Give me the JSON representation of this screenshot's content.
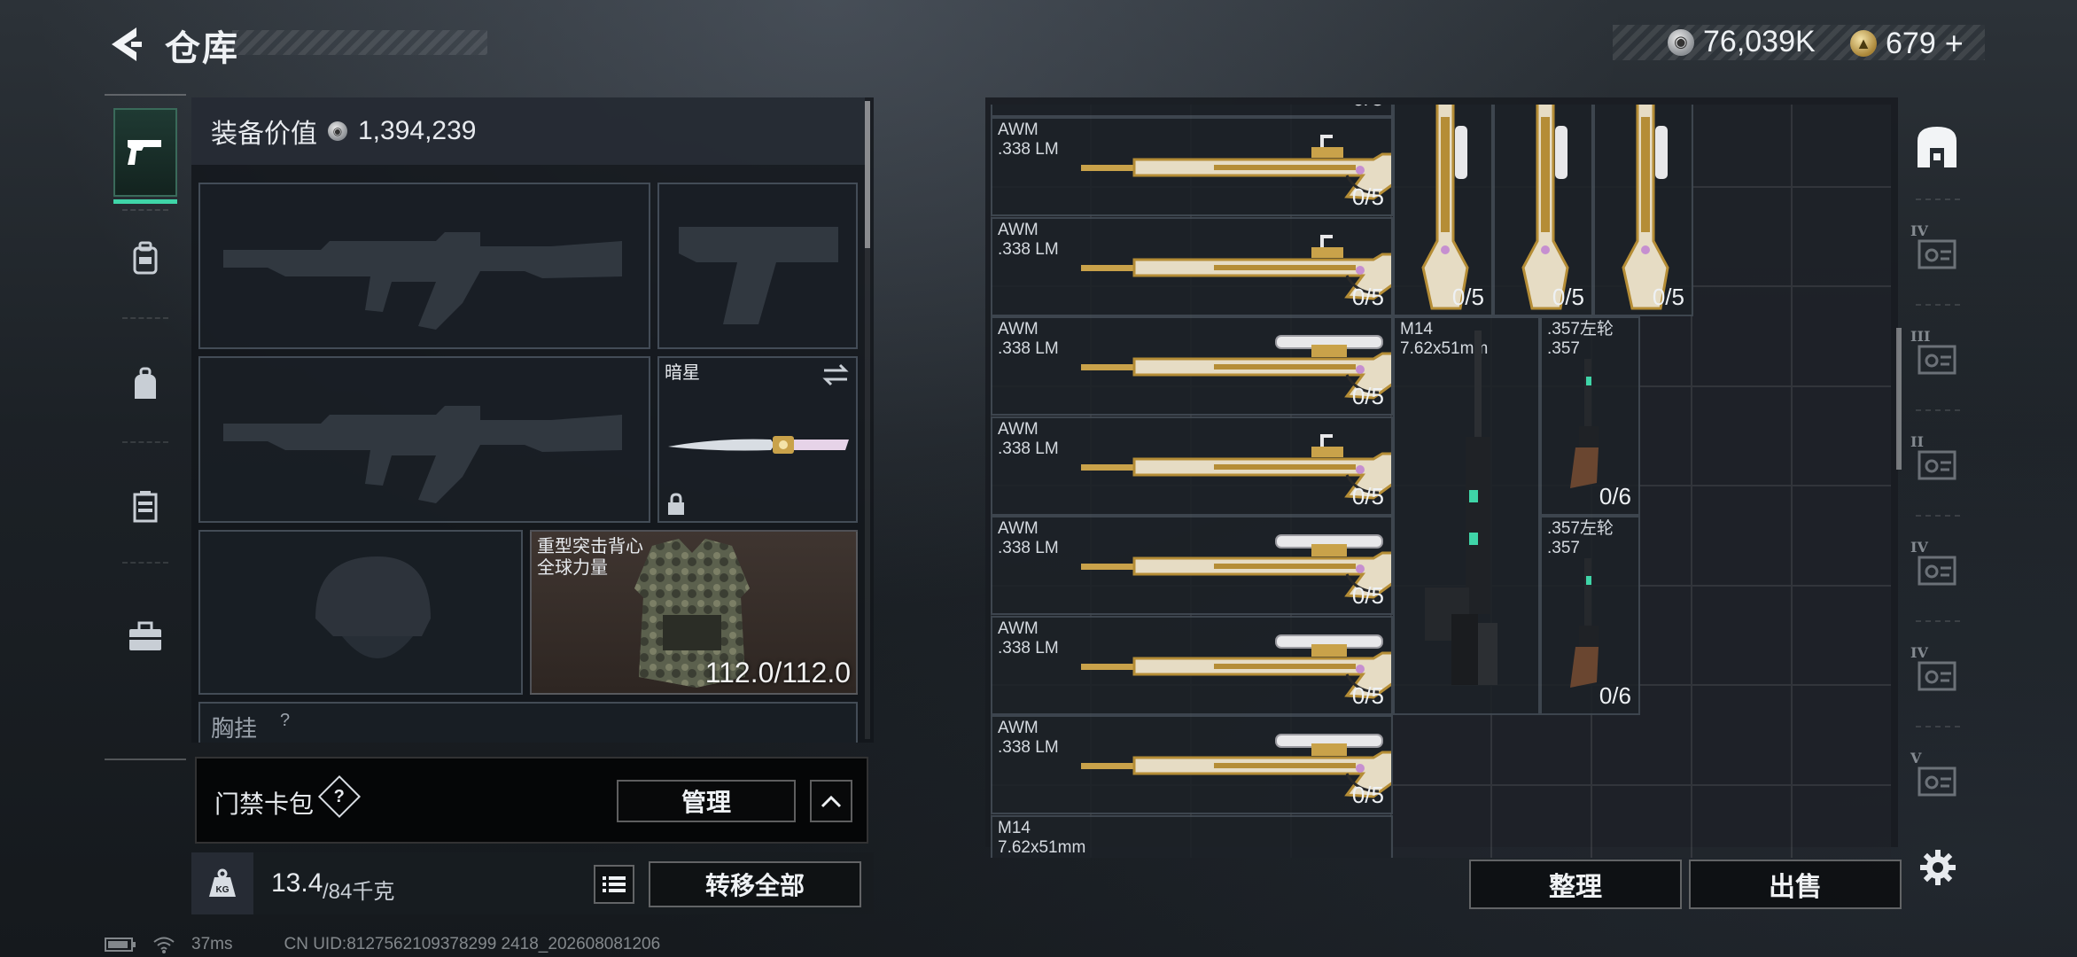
{
  "header": {
    "title": "仓库",
    "currency_silver": "76,039K",
    "currency_gold": "679",
    "gold_plus": "+"
  },
  "left_nav": {
    "items": [
      "pistol-icon",
      "backpack-icon",
      "bag-icon",
      "vest-icon",
      "toolbox-icon"
    ],
    "active_index": 0
  },
  "equipment": {
    "value_label": "装备价值",
    "value": "1,394,239",
    "melee_label": "暗星",
    "armor_name": "重型突击背心",
    "armor_brand": "全球力量",
    "armor_durability": "112.0/112.0",
    "chest_label": "胸挂",
    "chest_help": "?"
  },
  "keycard": {
    "label": "门禁卡包",
    "help": "?",
    "manage": "管理"
  },
  "weight": {
    "current": "13.4",
    "max": "/84千克",
    "transfer_all": "转移全部"
  },
  "stash": {
    "awm_rows": [
      {
        "name": "AWM\n.338 LM",
        "count": "0/5",
        "scope": "red-dot"
      },
      {
        "name": "AWM\n.338 LM",
        "count": "0/5",
        "scope": "red-dot"
      },
      {
        "name": "AWM\n.338 LM",
        "count": "0/5",
        "scope": "long"
      },
      {
        "name": "AWM\n.338 LM",
        "count": "0/5",
        "scope": "red-dot"
      },
      {
        "name": "AWM\n.338 LM",
        "count": "0/5",
        "scope": "long"
      },
      {
        "name": "AWM\n.338 LM",
        "count": "0/5",
        "scope": "long"
      },
      {
        "name": "AWM\n.338 LM",
        "count": "0/5",
        "scope": "long"
      }
    ],
    "top_row_count": "0/5",
    "vertical_counts": [
      "0/5",
      "0/5",
      "0/5"
    ],
    "m14": {
      "name": "M14\n7.62x51mm"
    },
    "m14_partial": "M14\n7.62x51mm",
    "revolvers": [
      {
        "name": ".357左轮\n.357",
        "count": "0/6"
      },
      {
        "name": ".357左轮\n.357",
        "count": "0/6"
      }
    ],
    "sort": "整理",
    "sell": "出售"
  },
  "categories": {
    "items": [
      "ammo-box-icon",
      "rank-iv-icon",
      "rank-iii-icon",
      "rank-ii-icon",
      "rank-iv-folder-icon",
      "rank-iv-card-icon",
      "rank-v-icon"
    ],
    "labels": [
      "",
      "IV",
      "III",
      "II",
      "IV",
      "IV",
      "V"
    ]
  },
  "status": {
    "ping": "37ms",
    "uid": "CN UID:8127562109378299 2418_202608081206"
  },
  "colors": {
    "accent_green": "#3fd5a8",
    "gold": "#c9a24a"
  }
}
